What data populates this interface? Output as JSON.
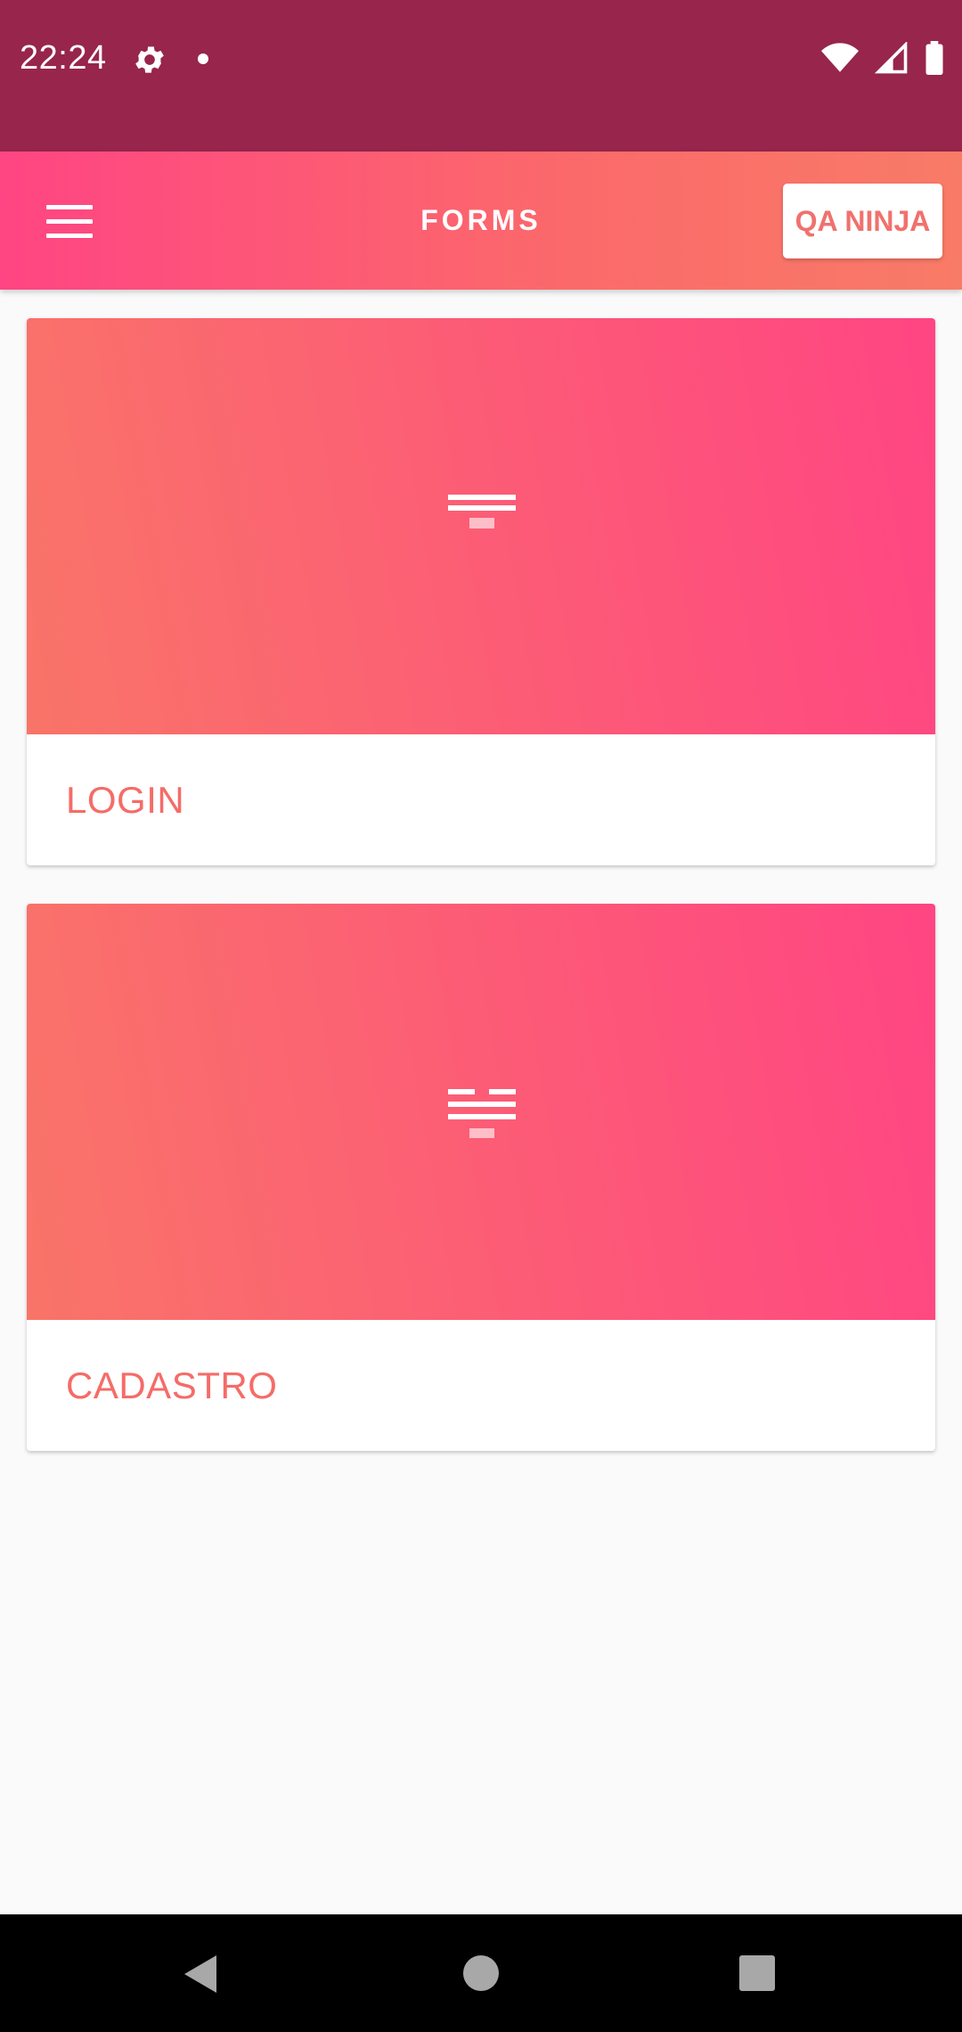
{
  "status_bar": {
    "time": "22:24",
    "icons": [
      "gear-icon",
      "notification-dot-icon",
      "wifi-icon",
      "signal-icon",
      "battery-icon"
    ],
    "color": "#97254c"
  },
  "app_bar": {
    "title": "FORMS",
    "action_button": "QA NINJA",
    "menu_icon": "hamburger-menu-icon",
    "gradient": [
      "#ff4583",
      "#f87b67"
    ]
  },
  "cards": [
    {
      "label": "LOGIN",
      "icon": "form-lines-icon"
    },
    {
      "label": "CADASTRO",
      "icon": "form-lines-icon"
    }
  ],
  "accent_color": "#f56c68",
  "nav_bar": {
    "buttons": [
      "back-icon",
      "home-icon",
      "recents-icon"
    ]
  }
}
